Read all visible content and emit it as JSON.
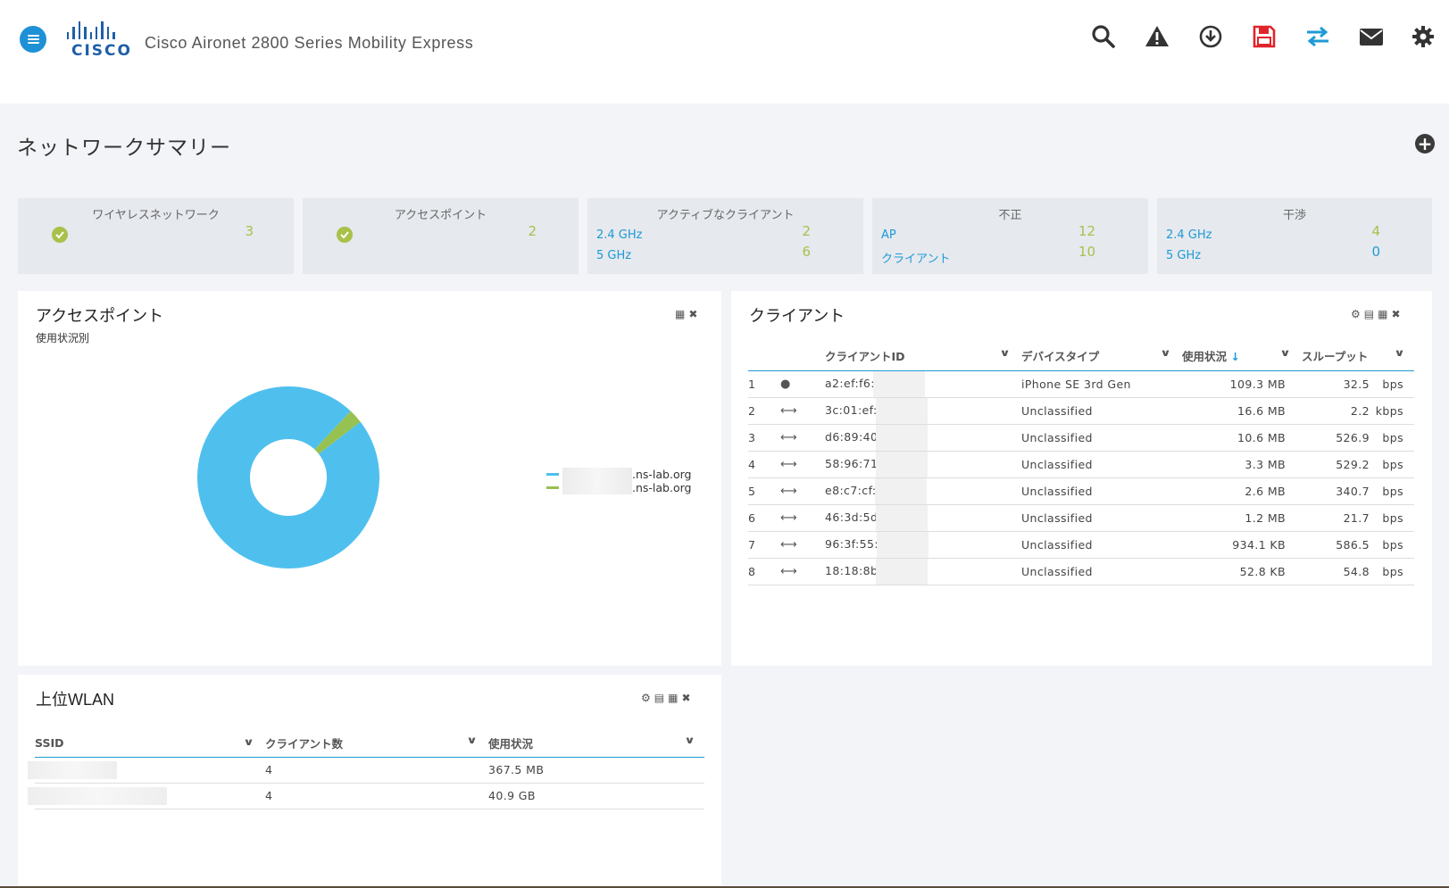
{
  "header": {
    "app_title": "Cisco Aironet 2800 Series Mobility Express",
    "logo_text": "CISCO",
    "toolbar": [
      "search-icon",
      "warning-icon",
      "download-icon",
      "save-icon",
      "transfer-icon",
      "mail-icon",
      "gear-icon"
    ]
  },
  "page": {
    "title": "ネットワークサマリー",
    "add_label": "+"
  },
  "summary": {
    "wireless": {
      "title": "ワイヤレスネットワーク",
      "value": "3"
    },
    "access_points": {
      "title": "アクセスポイント",
      "value": "2"
    },
    "active_clients": {
      "title": "アクティブなクライアント",
      "rows": [
        {
          "label": "2.4 GHz",
          "value": "2"
        },
        {
          "label": "5 GHz",
          "value": "6"
        }
      ]
    },
    "rogue": {
      "title": "不正",
      "rows": [
        {
          "label": "AP",
          "value": "12"
        },
        {
          "label": "クライアント",
          "value": "10"
        }
      ]
    },
    "interference": {
      "title": "干渉",
      "rows": [
        {
          "label": "2.4 GHz",
          "value": "4"
        },
        {
          "label": "5 GHz",
          "value": "0"
        }
      ]
    }
  },
  "ap_panel": {
    "title": "アクセスポイント",
    "subtitle": "使用状況別",
    "legend": [
      {
        "suffix": ".ns-lab.org",
        "color": "#4fc0ee"
      },
      {
        "suffix": ".ns-lab.org",
        "color": "#97c150"
      }
    ],
    "chart_data": {
      "type": "pie",
      "donut": true,
      "categories": [
        ".ns-lab.org",
        ".ns-lab.org"
      ],
      "values": [
        97.5,
        2.5
      ],
      "colors": [
        "#4fc0ee",
        "#97c150"
      ]
    }
  },
  "clients_panel": {
    "title": "クライアント",
    "columns": {
      "id": "クライアントID",
      "device": "デバイスタイプ",
      "usage": "使用状況",
      "throughput": "スループット"
    },
    "rows": [
      {
        "n": "1",
        "icon": "apple-icon",
        "id": "a2:ef:f6:",
        "device": "iPhone SE 3rd Gen",
        "usage": "109.3 MB",
        "tp": "32.5",
        "unit": "bps"
      },
      {
        "n": "2",
        "icon": "link-icon",
        "id": "3c:01:ef:",
        "device": "Unclassified",
        "usage": "16.6 MB",
        "tp": "2.2",
        "unit": "kbps"
      },
      {
        "n": "3",
        "icon": "link-icon",
        "id": "d6:89:40",
        "device": "Unclassified",
        "usage": "10.6 MB",
        "tp": "526.9",
        "unit": "bps"
      },
      {
        "n": "4",
        "icon": "link-icon",
        "id": "58:96:71",
        "device": "Unclassified",
        "usage": "3.3 MB",
        "tp": "529.2",
        "unit": "bps"
      },
      {
        "n": "5",
        "icon": "link-icon",
        "id": "e8:c7:cf:",
        "device": "Unclassified",
        "usage": "2.6 MB",
        "tp": "340.7",
        "unit": "bps"
      },
      {
        "n": "6",
        "icon": "link-icon",
        "id": "46:3d:5d",
        "device": "Unclassified",
        "usage": "1.2 MB",
        "tp": "21.7",
        "unit": "bps"
      },
      {
        "n": "7",
        "icon": "link-icon",
        "id": "96:3f:55:",
        "device": "Unclassified",
        "usage": "934.1 KB",
        "tp": "586.5",
        "unit": "bps"
      },
      {
        "n": "8",
        "icon": "link-icon",
        "id": "18:18:8b",
        "device": "Unclassified",
        "usage": "52.8 KB",
        "tp": "54.8",
        "unit": "bps"
      }
    ]
  },
  "wlan_panel": {
    "title": "上位WLAN",
    "columns": {
      "ssid": "SSID",
      "clients": "クライアント数",
      "usage": "使用状況"
    },
    "rows": [
      {
        "clients": "4",
        "usage": "367.5 MB"
      },
      {
        "clients": "4",
        "usage": "40.9 GB"
      }
    ]
  },
  "colors": {
    "accent": "#1e9ad6",
    "green": "#a8c14a",
    "save_red": "#e0242b"
  }
}
